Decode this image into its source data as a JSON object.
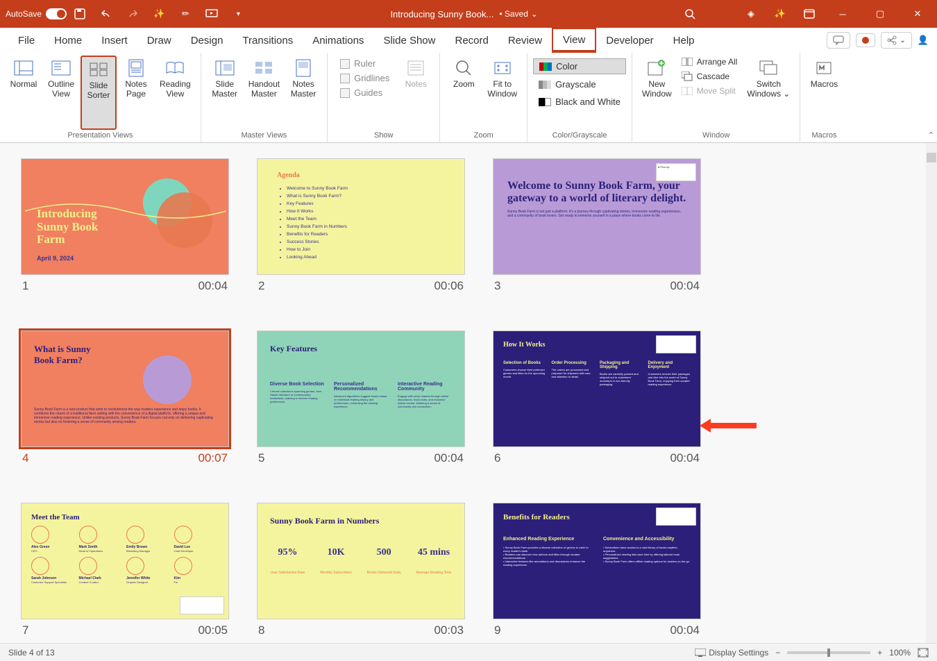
{
  "titlebar": {
    "autosave_label": "AutoSave",
    "autosave_on": "On",
    "doc_title": "Introducing Sunny Book...",
    "saved_label": "• Saved",
    "saved_caret": "⌄"
  },
  "tabs": {
    "file": "File",
    "home": "Home",
    "insert": "Insert",
    "draw": "Draw",
    "design": "Design",
    "transitions": "Transitions",
    "animations": "Animations",
    "slideshow": "Slide Show",
    "record": "Record",
    "review": "Review",
    "view": "View",
    "developer": "Developer",
    "help": "Help"
  },
  "ribbon": {
    "presentation_views": {
      "label": "Presentation Views",
      "normal": "Normal",
      "outline": "Outline\nView",
      "sorter": "Slide\nSorter",
      "notes": "Notes\nPage",
      "reading": "Reading\nView"
    },
    "master_views": {
      "label": "Master Views",
      "slide": "Slide\nMaster",
      "handout": "Handout\nMaster",
      "notes": "Notes\nMaster"
    },
    "show": {
      "label": "Show",
      "ruler": "Ruler",
      "gridlines": "Gridlines",
      "guides": "Guides",
      "notes": "Notes"
    },
    "zoom": {
      "label": "Zoom",
      "zoom": "Zoom",
      "fit": "Fit to\nWindow"
    },
    "color": {
      "label": "Color/Grayscale",
      "color": "Color",
      "grayscale": "Grayscale",
      "bw": "Black and White"
    },
    "window": {
      "label": "Window",
      "new": "New\nWindow",
      "arrange": "Arrange All",
      "cascade": "Cascade",
      "movesplit": "Move Split",
      "switch": "Switch\nWindows"
    },
    "macros": {
      "label": "Macros",
      "macros": "Macros"
    }
  },
  "slides": [
    {
      "num": "1",
      "time": "00:04",
      "title": "Introducing\nSunny Book\nFarm",
      "date": "April 9, 2024"
    },
    {
      "num": "2",
      "time": "00:06",
      "agenda_title": "Agenda",
      "items": [
        "Welcome to Sunny Book Farm",
        "What is Sunny Book Farm?",
        "Key Features",
        "How It Works",
        "Meet the Team",
        "Sunny Book Farm in Numbers",
        "Benefits for Readers",
        "Success Stories",
        "How to Join",
        "Looking Ahead"
      ]
    },
    {
      "num": "3",
      "time": "00:04",
      "heading": "Welcome to Sunny Book Farm, your gateway to a world of literary delight.",
      "sub": "Sunny Book Farm is not just a platform; it's a journey through captivating stories, immersive reading experiences, and a community of book lovers. Get ready to immerse yourself in a place where books come to life."
    },
    {
      "num": "4",
      "time": "00:07",
      "heading": "What is Sunny\nBook Farm?",
      "body": "Sunny Book Farm is a new product that aims to revolutionize the way readers experience and enjoy books. It combines the charm of a traditional farm setting with the convenience of a digital platform, offering a unique and immersive reading experience. Unlike existing products, Sunny Book Farm focuses not only on delivering captivating stories but also on fostering a sense of community among readers."
    },
    {
      "num": "5",
      "time": "00:04",
      "heading": "Key Features",
      "cols": [
        {
          "h": "Diverse Book Selection",
          "b": "Choose collections spanning genres, from classic literature to contemporary bestsellers, catering to diverse reading preferences."
        },
        {
          "h": "Personalized Recommendations",
          "b": "Advanced algorithms suggest books based on individual reading history and preferences, enhancing the reading experience."
        },
        {
          "h": "Interactive Reading Community",
          "b": "Engage with other readers through online discussions, book clubs, and exclusive author events, fostering a sense of community and connection."
        }
      ]
    },
    {
      "num": "6",
      "time": "00:04",
      "heading": "How It Works",
      "steps": [
        {
          "h": "Selection of Books",
          "b": "Customers choose their preferred genres and titles for the upcoming month."
        },
        {
          "h": "Order Processing",
          "b": "The orders are processed and prepared for shipment with care and attention to detail."
        },
        {
          "h": "Packaging and Shipping",
          "b": "Books are carefully packed and shipped out to customers' doorsteps in eco-friendly packaging."
        },
        {
          "h": "Delivery and Enjoyment",
          "b": "Customers receive their packages and dive into the world of Sunny Book Farm, enjoying their curated reading experience."
        }
      ]
    },
    {
      "num": "7",
      "time": "00:05",
      "heading": "Meet the Team",
      "members": [
        {
          "n": "Alex Green",
          "r": "CEO"
        },
        {
          "n": "Mark Smith",
          "r": "Head of Operations"
        },
        {
          "n": "Emily Brown",
          "r": "Marketing Manager"
        },
        {
          "n": "David Lee",
          "r": "Lead Developer"
        },
        {
          "n": "Sarah Johnson",
          "r": "Customer Support Specialist"
        },
        {
          "n": "Michael Clark",
          "r": "Content Curator"
        },
        {
          "n": "Jennifer White",
          "r": "Graphic Designer"
        },
        {
          "n": "Kim",
          "r": "Fin"
        }
      ]
    },
    {
      "num": "8",
      "time": "00:03",
      "heading": "Sunny Book Farm in Numbers",
      "nums": [
        {
          "v": "95%",
          "l": "User Satisfaction Rate"
        },
        {
          "v": "10K",
          "l": "Monthly Subscribers"
        },
        {
          "v": "500",
          "l": "Books Delivered Daily"
        },
        {
          "v": "45 mins",
          "l": "Average Reading Time"
        }
      ]
    },
    {
      "num": "9",
      "time": "00:04",
      "heading": "Benefits for Readers",
      "cols": [
        {
          "h": "Enhanced Reading Experience",
          "items": [
            "Sunny Book Farm provides a diverse collection of genres to cater to every reader's taste.",
            "Readers can discover new authors and titles through curated recommendations.",
            "Interactive features like annotations and discussions enhance the reading experience."
          ]
        },
        {
          "h": "Convenience and Accessibility",
          "items": [
            "Subscribers have access to a vast library of books anytime, anywhere.",
            "Personalized reading lists save time by offering tailored book suggestions.",
            "Sunny Book Farm offers offline reading options for readers on the go."
          ]
        }
      ]
    }
  ],
  "statusbar": {
    "slide_info": "Slide 4 of 13",
    "display_settings": "Display Settings",
    "zoom": "100%"
  }
}
